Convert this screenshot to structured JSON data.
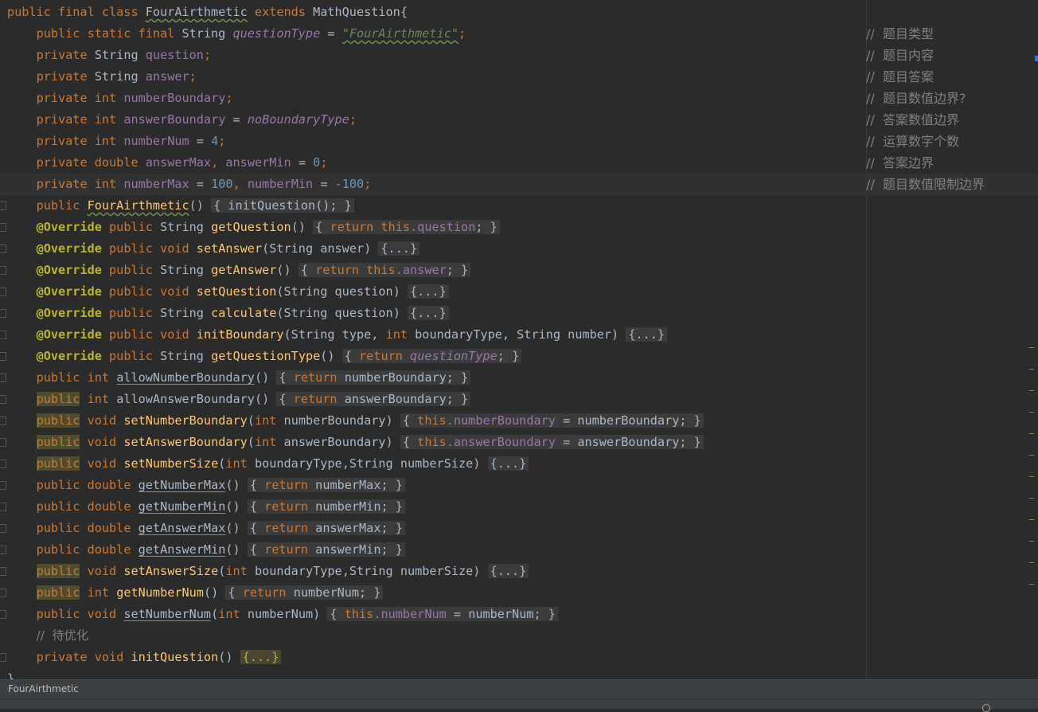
{
  "editor": {
    "class_header": {
      "kw1": "public final class",
      "class_name": "FourAirthmetic",
      "kw2": "extends",
      "superclass": "MathQuestion{"
    },
    "fields": {
      "f1": {
        "mods": "public static final",
        "type": "String",
        "name": "questionType",
        "eq": "=",
        "value": "\"FourAirthmetic\"",
        "end": ";",
        "comment": "//  题目类型"
      },
      "f2": {
        "mods": "private",
        "type": "String",
        "name": "question",
        "end": ";",
        "comment": "//  题目内容"
      },
      "f3": {
        "mods": "private",
        "type": "String",
        "name": "answer",
        "end": ";",
        "comment": "//  题目答案"
      },
      "f4": {
        "mods": "private",
        "type": "int",
        "name": "numberBoundary",
        "end": ";",
        "comment": "//  题目数值边界?"
      },
      "f5": {
        "mods": "private",
        "type": "int",
        "name": "answerBoundary",
        "eq": "=",
        "value": "noBoundaryType",
        "end": ";",
        "comment": "//  答案数值边界"
      },
      "f6": {
        "mods": "private",
        "type": "int",
        "name": "numberNum",
        "eq": "=",
        "value": "4",
        "end": ";",
        "comment": "//  运算数字个数"
      },
      "f7": {
        "mods": "private",
        "type": "double",
        "name": "answerMax",
        "comma": ",",
        "name2": "answerMin",
        "eq": "=",
        "value": "0",
        "end": ";",
        "comment": "//  答案边界"
      },
      "f8": {
        "mods": "private",
        "type": "int",
        "name": "numberMax",
        "eq": "=",
        "value": "100",
        "comma": ",",
        "name2": "numberMin",
        "eq2": "=",
        "value2": "-100",
        "end": ";",
        "comment": "//  题目数值限制边界"
      }
    },
    "methods": {
      "m1": {
        "mods": "public",
        "name": "FourAirthmetic",
        "params": "()",
        "body": "{ initQuestion(); }"
      },
      "m2": {
        "ann": "@Override",
        "mods": "public",
        "ret": "String",
        "name": "getQuestion",
        "params": "()",
        "body_open": "{",
        "body_kw": "return this",
        "body_field": ".question",
        "body_close": "; }"
      },
      "m3": {
        "ann": "@Override",
        "mods": "public",
        "ret": "void",
        "name": "setAnswer",
        "params": "(String answer)",
        "fold": "{...}"
      },
      "m4": {
        "ann": "@Override",
        "mods": "public",
        "ret": "String",
        "name": "getAnswer",
        "params": "()",
        "body_open": "{",
        "body_kw": "return this",
        "body_field": ".answer",
        "body_close": "; }"
      },
      "m5": {
        "ann": "@Override",
        "mods": "public",
        "ret": "void",
        "name": "setQuestion",
        "params": "(String question)",
        "fold": "{...}"
      },
      "m6": {
        "ann": "@Override",
        "mods": "public",
        "ret": "String",
        "name": "calculate",
        "params": "(String question)",
        "fold": "{...}"
      },
      "m7": {
        "ann": "@Override",
        "mods": "public",
        "ret": "void",
        "name": "initBoundary",
        "params_a": "(String type,",
        "params_kw": "int",
        "params_b": "boundaryType, String number)",
        "fold": "{...}"
      },
      "m8": {
        "ann": "@Override",
        "mods": "public",
        "ret": "String",
        "name": "getQuestionType",
        "params": "()",
        "body_open": "{",
        "body_kw": "return",
        "body_field": "questionType",
        "body_close": "; }"
      },
      "m9": {
        "mods": "public",
        "ret": "int",
        "name": "allowNumberBoundary",
        "params": "()",
        "body_open": "{",
        "body_kw": "return",
        "body_plain": "numberBoundary",
        "body_close": "; }"
      },
      "m10": {
        "mods": "public",
        "ret": "int",
        "name": "allowAnswerBoundary",
        "params": "()",
        "body_open": "{",
        "body_kw": "return",
        "body_plain": "answerBoundary",
        "body_close": "; }"
      },
      "m11": {
        "mods": "public",
        "ret": "void",
        "name": "setNumberBoundary",
        "params_a": "(",
        "params_kw": "int",
        "params_b": "numberBoundary)",
        "body_open": "{",
        "body_kw": "this",
        "body_field": ".numberBoundary",
        "body_plain": "= numberBoundary",
        "body_close": "; }"
      },
      "m12": {
        "mods": "public",
        "ret": "void",
        "name": "setAnswerBoundary",
        "params_a": "(",
        "params_kw": "int",
        "params_b": "answerBoundary)",
        "body_open": "{",
        "body_kw": "this",
        "body_field": ".answerBoundary",
        "body_plain": "= answerBoundary",
        "body_close": "; }"
      },
      "m13": {
        "mods": "public",
        "ret": "void",
        "name": "setNumberSize",
        "params_a": "(",
        "params_kw": "int",
        "params_b": "boundaryType,String numberSize)",
        "fold": "{...}"
      },
      "m14": {
        "mods": "public",
        "ret": "double",
        "name": "getNumberMax",
        "params": "()",
        "body_open": "{",
        "body_kw": "return",
        "body_plain": "numberMax",
        "body_close": "; }"
      },
      "m15": {
        "mods": "public",
        "ret": "double",
        "name": "getNumberMin",
        "params": "()",
        "body_open": "{",
        "body_kw": "return",
        "body_plain": "numberMin",
        "body_close": "; }"
      },
      "m16": {
        "mods": "public",
        "ret": "double",
        "name": "getAnswerMax",
        "params": "()",
        "body_open": "{",
        "body_kw": "return",
        "body_plain": "answerMax",
        "body_close": "; }"
      },
      "m17": {
        "mods": "public",
        "ret": "double",
        "name": "getAnswerMin",
        "params": "()",
        "body_open": "{",
        "body_kw": "return",
        "body_plain": "answerMin",
        "body_close": "; }"
      },
      "m18": {
        "mods": "public",
        "ret": "void",
        "name": "setAnswerSize",
        "params_a": "(",
        "params_kw": "int",
        "params_b": "boundaryType,String numberSize)",
        "fold": "{...}"
      },
      "m19": {
        "mods": "public",
        "ret": "int",
        "name": "getNumberNum",
        "params": "()",
        "body_open": "{",
        "body_kw": "return",
        "body_plain": "numberNum",
        "body_close": "; }"
      },
      "m20": {
        "mods": "public",
        "ret": "void",
        "name": "setNumberNum",
        "params_a": "(",
        "params_kw": "int",
        "params_b": "numberNum)",
        "body_open": "{",
        "body_kw": "this",
        "body_field": ".numberNum",
        "body_plain": "= numberNum",
        "body_close": "; }"
      },
      "todo_comment": "//  待优化",
      "m21": {
        "mods": "private",
        "ret": "void",
        "name": "initQuestion",
        "params": "()",
        "fold": "{...}"
      }
    },
    "closing_brace": "}"
  },
  "breadcrumb": {
    "label": "FourAirthmetic"
  },
  "colors": {
    "background": "#2b2b2b",
    "keyword": "#cc7832",
    "method": "#ffc66d",
    "field": "#9876aa",
    "string": "#6a8759",
    "number": "#6897bb",
    "annotation": "#bbb529",
    "comment": "#808080"
  }
}
